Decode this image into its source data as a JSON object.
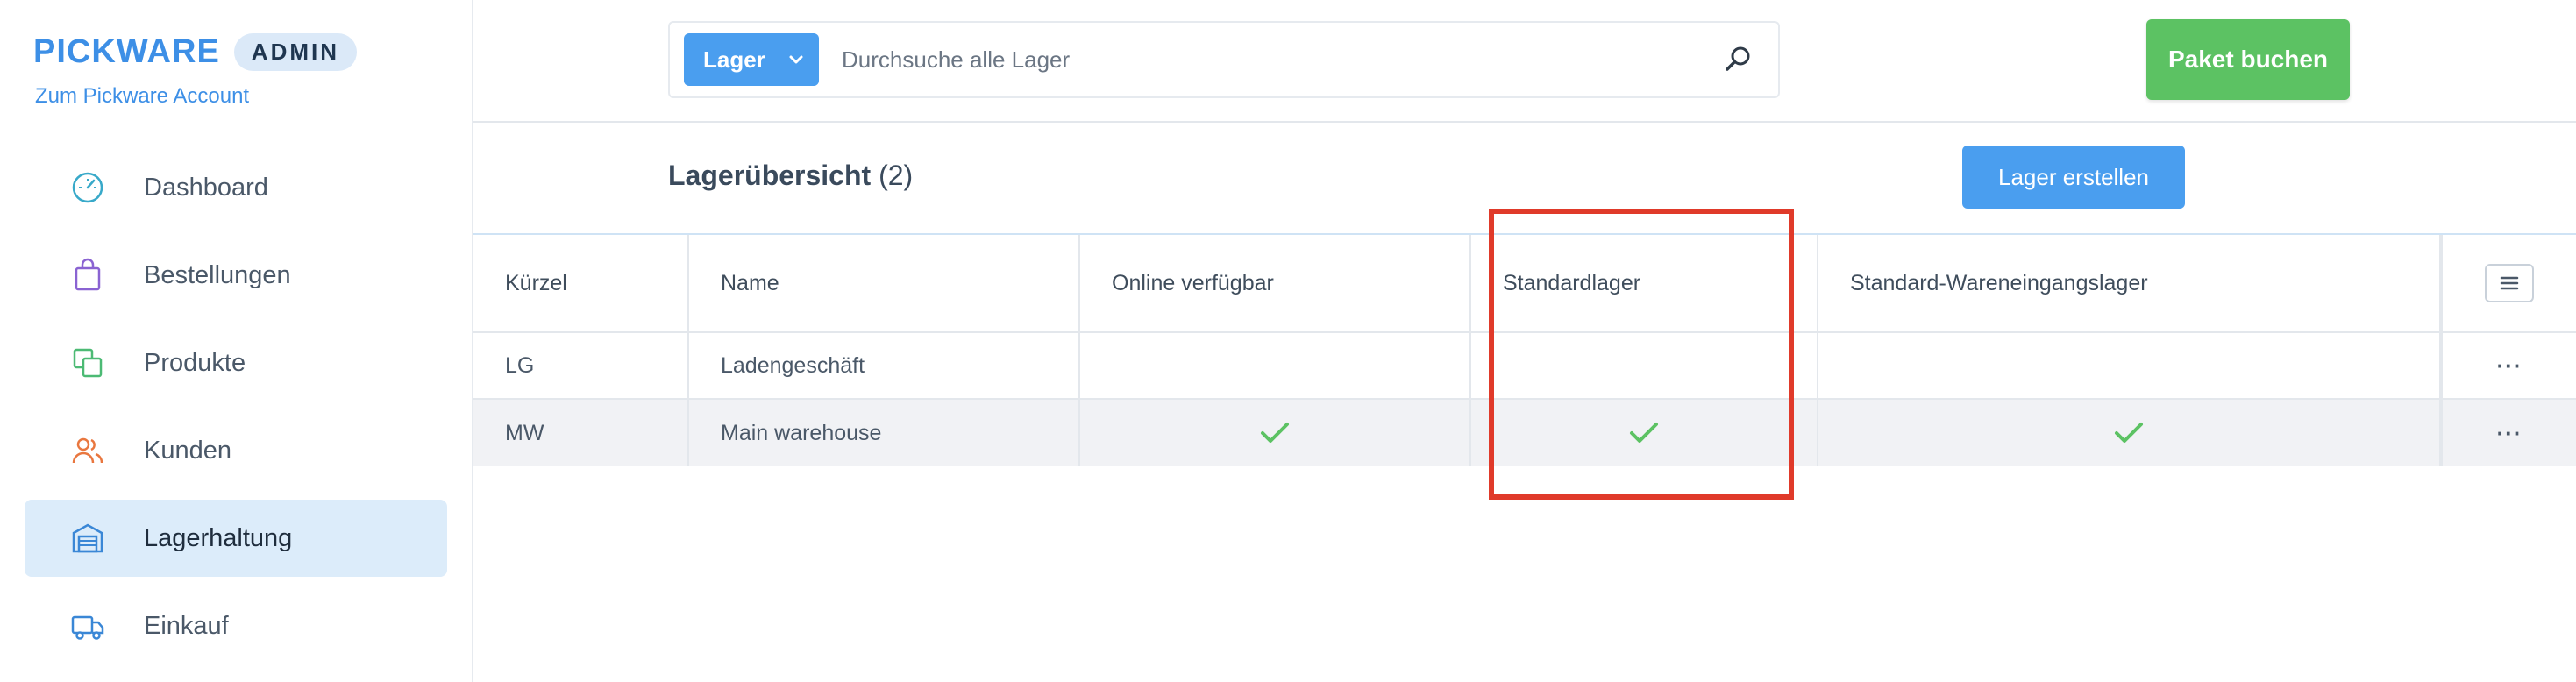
{
  "brand": {
    "name": "PICKWARE",
    "badge": "ADMIN",
    "account_link": "Zum Pickware Account"
  },
  "sidebar": {
    "items": [
      {
        "label": "Dashboard",
        "icon": "dashboard-gauge-icon",
        "active": false
      },
      {
        "label": "Bestellungen",
        "icon": "shopping-bag-icon",
        "active": false
      },
      {
        "label": "Produkte",
        "icon": "products-squares-icon",
        "active": false
      },
      {
        "label": "Kunden",
        "icon": "users-icon",
        "active": false
      },
      {
        "label": "Lagerhaltung",
        "icon": "warehouse-icon",
        "active": true
      },
      {
        "label": "Einkauf",
        "icon": "truck-icon",
        "active": false
      }
    ]
  },
  "topbar": {
    "search_scope": "Lager",
    "search_placeholder": "Durchsuche alle Lager",
    "cta_label": "Paket buchen"
  },
  "page": {
    "title": "Lagerübersicht",
    "count": "(2)",
    "create_label": "Lager erstellen"
  },
  "table": {
    "columns": [
      "Kürzel",
      "Name",
      "Online verfügbar",
      "Standardlager",
      "Standard-Wareneingangslager"
    ],
    "rows": [
      {
        "kuerzel": "LG",
        "name": "Ladengeschäft",
        "online": false,
        "standard": false,
        "wareneingang": false
      },
      {
        "kuerzel": "MW",
        "name": "Main warehouse",
        "online": true,
        "standard": true,
        "wareneingang": true
      }
    ],
    "row_menu": "···"
  },
  "colors": {
    "brand_blue": "#3d8fe6",
    "primary_button": "#4a9eef",
    "cta_green": "#5cc263",
    "check_green": "#5cc263",
    "highlight_red": "#e03a2a",
    "active_nav_bg": "#dcecfa"
  }
}
